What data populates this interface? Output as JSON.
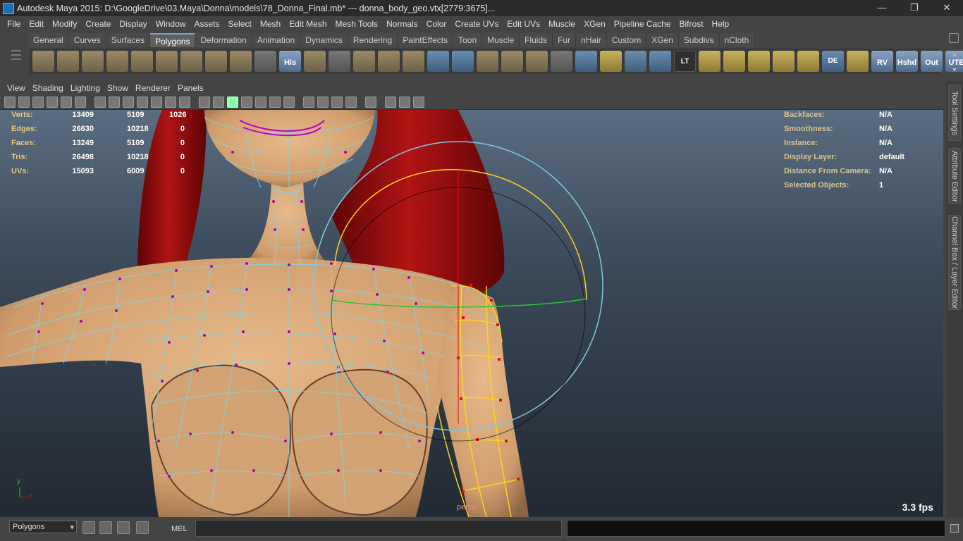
{
  "window": {
    "title": "Autodesk Maya 2015: D:\\GoogleDrive\\03.Maya\\Donna\\models\\78_Donna_Final.mb*   ---   donna_body_geo.vtx[2779:3675]...",
    "minimize": "—",
    "maximize": "❐",
    "close": "✕"
  },
  "menubar": [
    "File",
    "Edit",
    "Modify",
    "Create",
    "Display",
    "Window",
    "Assets",
    "Select",
    "Mesh",
    "Edit Mesh",
    "Mesh Tools",
    "Normals",
    "Color",
    "Create UVs",
    "Edit UVs",
    "Muscle",
    "XGen",
    "Pipeline Cache",
    "Bifrost",
    "Help"
  ],
  "shelf": {
    "tabs": [
      "General",
      "Curves",
      "Surfaces",
      "Polygons",
      "Deformation",
      "Animation",
      "Dynamics",
      "Rendering",
      "PaintEffects",
      "Toon",
      "Muscle",
      "Fluids",
      "Fur",
      "nHair",
      "Custom",
      "XGen",
      "Subdivs",
      "nCloth"
    ],
    "active_tab": "Polygons",
    "icons": [
      {
        "name": "poly-sphere-icon",
        "label": ""
      },
      {
        "name": "poly-cube-icon",
        "label": ""
      },
      {
        "name": "poly-cylinder-icon",
        "label": ""
      },
      {
        "name": "poly-cone-icon",
        "label": ""
      },
      {
        "name": "poly-plane-icon",
        "label": ""
      },
      {
        "name": "poly-torus-icon",
        "label": ""
      },
      {
        "name": "poly-pyramid-icon",
        "label": ""
      },
      {
        "name": "poly-pipe-icon",
        "label": ""
      },
      {
        "name": "poly-helix-icon",
        "label": ""
      },
      {
        "name": "poly-soccer-ball-icon",
        "label": ""
      },
      {
        "name": "history-icon",
        "label": "His"
      },
      {
        "name": "poly-extrude-icon",
        "label": ""
      },
      {
        "name": "poly-bridge-icon",
        "label": ""
      },
      {
        "name": "poly-append-icon",
        "label": ""
      },
      {
        "name": "poly-split-icon",
        "label": ""
      },
      {
        "name": "poly-merge-icon",
        "label": ""
      },
      {
        "name": "poly-bevel-icon",
        "label": ""
      },
      {
        "name": "poly-smooth-icon",
        "label": ""
      },
      {
        "name": "poly-combine-icon",
        "label": ""
      },
      {
        "name": "poly-separate-icon",
        "label": ""
      },
      {
        "name": "poly-mirror-icon",
        "label": ""
      },
      {
        "name": "paint-brush-icon",
        "label": ""
      },
      {
        "name": "wireframe-cube-icon",
        "label": ""
      },
      {
        "name": "snap-magnet-icon",
        "label": ""
      },
      {
        "name": "rotate-sphere-icon",
        "label": ""
      },
      {
        "name": "transfer-attr-icon",
        "label": ""
      },
      {
        "name": "lt-script-icon",
        "label": "LT"
      },
      {
        "name": "uv-layout-icon-1",
        "label": ""
      },
      {
        "name": "uv-layout-icon-2",
        "label": ""
      },
      {
        "name": "uv-layout-icon-3",
        "label": ""
      },
      {
        "name": "uv-layout-icon-4",
        "label": ""
      },
      {
        "name": "uv-layout-icon-5",
        "label": ""
      },
      {
        "name": "de-script-icon",
        "label": "DE"
      },
      {
        "name": "uv-layout-icon-6",
        "label": ""
      },
      {
        "name": "rv-script-icon",
        "label": "RV"
      },
      {
        "name": "hshd-script-icon",
        "label": "Hshd"
      },
      {
        "name": "out-script-icon",
        "label": "Out"
      },
      {
        "name": "ute-script-icon",
        "label": "UTE"
      }
    ]
  },
  "panel_menu": [
    "View",
    "Shading",
    "Lighting",
    "Show",
    "Renderer",
    "Panels"
  ],
  "hud_left": [
    {
      "label": "Verts:",
      "a": "13409",
      "b": "5109",
      "c": "1026"
    },
    {
      "label": "Edges:",
      "a": "26630",
      "b": "10218",
      "c": "0"
    },
    {
      "label": "Faces:",
      "a": "13249",
      "b": "5109",
      "c": "0"
    },
    {
      "label": "Tris:",
      "a": "26498",
      "b": "10218",
      "c": "0"
    },
    {
      "label": "UVs:",
      "a": "15093",
      "b": "6009",
      "c": "0"
    }
  ],
  "hud_right": [
    {
      "label": "Backfaces:",
      "value": "N/A"
    },
    {
      "label": "Smoothness:",
      "value": "N/A"
    },
    {
      "label": "Instance:",
      "value": "N/A"
    },
    {
      "label": "Display Layer:",
      "value": "default"
    },
    {
      "label": "Distance From Camera:",
      "value": "N/A"
    },
    {
      "label": "Selected Objects:",
      "value": "1"
    }
  ],
  "viewport": {
    "camera": "persp",
    "fps": "3.3 fps",
    "axis_y": "y",
    "axis_x": "x"
  },
  "side_tabs": [
    "Tool Settings",
    "Attribute Editor",
    "Channel Box / Layer Editor"
  ],
  "command_line": {
    "mode": "Polygons",
    "mel_label": "MEL"
  },
  "colors": {
    "wire": "#7fd3e6",
    "vertex": "#b000b0",
    "hair": "#9e0c0c",
    "skin": "#d9ac80",
    "selection": "#ffd21a",
    "gizmo_circle": "#7cc8e6"
  }
}
